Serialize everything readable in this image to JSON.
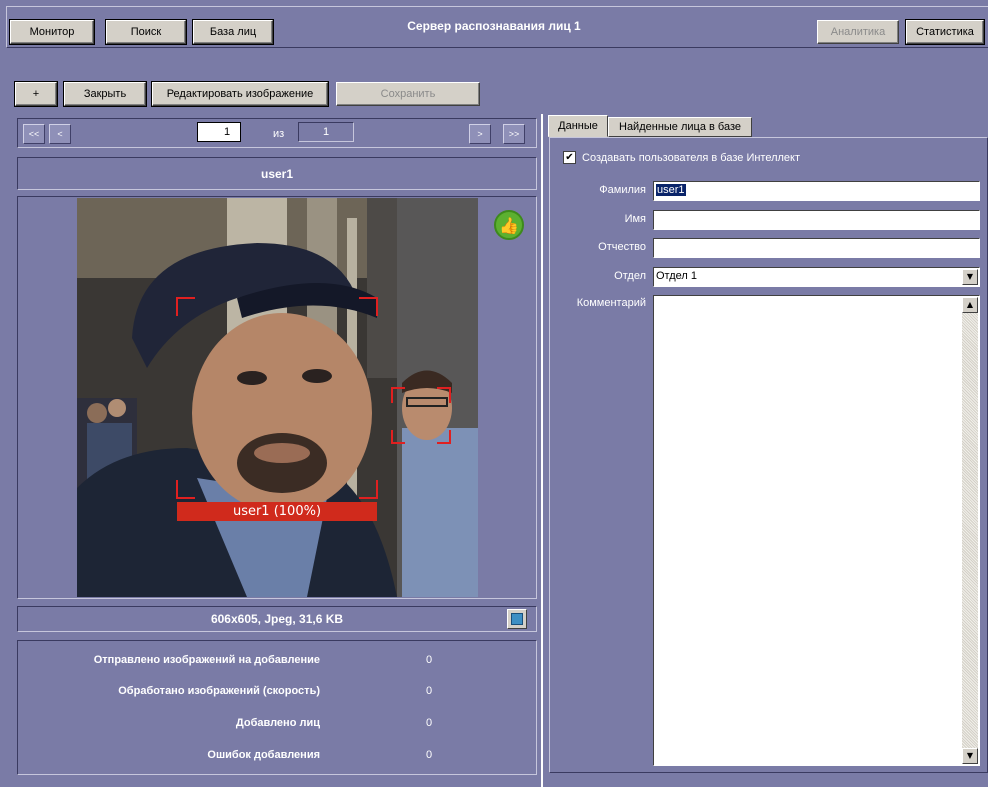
{
  "toolbar": {
    "monitor": "Монитор",
    "search": "Поиск",
    "face_db": "База лиц",
    "title": "Сервер распознавания лиц 1",
    "analytics": "Аналитика",
    "statistics": "Статистика"
  },
  "actions": {
    "add": "+",
    "close": "Закрыть",
    "edit_image": "Редактировать изображение",
    "save": "Сохранить"
  },
  "pager": {
    "first": "<<",
    "prev": "<",
    "current": "1",
    "of": "из",
    "total": "1",
    "next": ">",
    "last": ">>"
  },
  "image_panel": {
    "user_name": "user1",
    "face_label": "user1 (100%)",
    "file_info": "606x605, Jpeg, 31,6 KB"
  },
  "stats": [
    {
      "label": "Отправлено изображений на добавление",
      "value": "0"
    },
    {
      "label": "Обработано изображений (скорость)",
      "value": "0"
    },
    {
      "label": "Добавлено лиц",
      "value": "0"
    },
    {
      "label": "Ошибок добавления",
      "value": "0"
    }
  ],
  "tabs": {
    "data": "Данные",
    "found": "Найденные лица в базе"
  },
  "form": {
    "create_user_label": "Создавать пользователя в базе Интеллект",
    "create_user_checked": true,
    "surname_label": "Фамилия",
    "surname_value": "user1",
    "name_label": "Имя",
    "name_value": "",
    "patronymic_label": "Отчество",
    "patronymic_value": "",
    "dept_label": "Отдел",
    "dept_value": "Отдел 1",
    "comment_label": "Комментарий",
    "comment_value": ""
  }
}
